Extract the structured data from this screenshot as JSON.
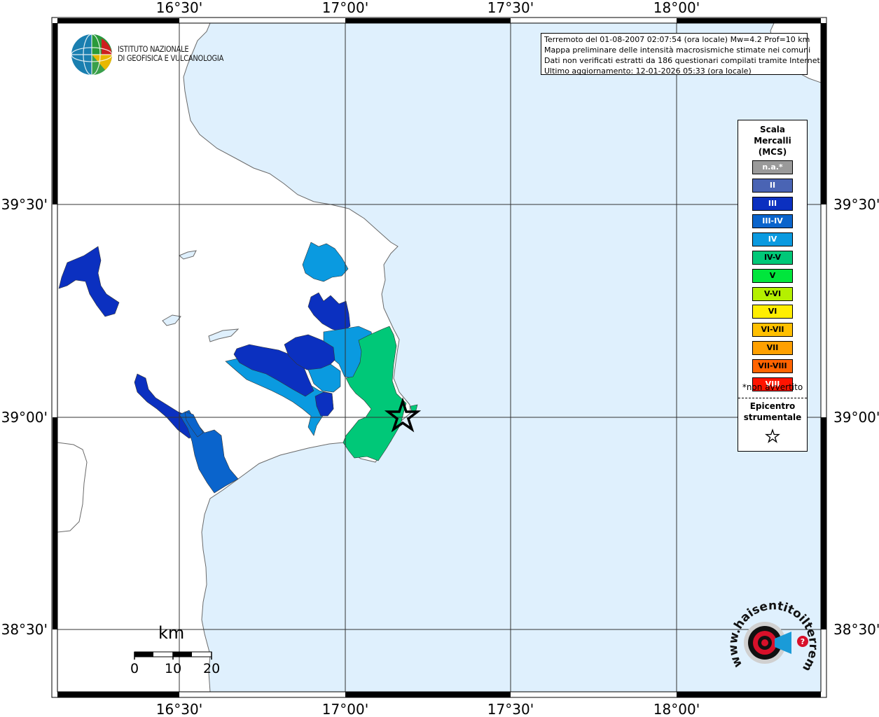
{
  "map": {
    "top_ticks": [
      "16°30'",
      "17°00'",
      "17°30'",
      "18°00'"
    ],
    "bottom_ticks": [
      "16°30'",
      "17°00'",
      "17°30'",
      "18°00'"
    ],
    "left_ticks": [
      "39°30'",
      "39°00'",
      "38°30'"
    ],
    "right_ticks": [
      "39°30'",
      "39°00'",
      "38°30'"
    ]
  },
  "logo": {
    "line1": "ISTITUTO NAZIONALE",
    "line2": "DI GEOFISICA E VULCANOLOGIA"
  },
  "info": {
    "line1": "Terremoto del 01-08-2007 02:07:54 (ora locale) Mw=4.2 Prof=10 km",
    "line2": "Mappa preliminare delle intensità macrosismiche stimate nei comuni",
    "line3": "Dati non verificati estratti da 186 questionari compilati tramite Internet.",
    "line4": "Ultimo aggiornamento: 12-01-2026 05:33 (ora locale)"
  },
  "legend": {
    "title1": "Scala",
    "title2": "Mercalli",
    "title3": "(MCS)",
    "items": [
      {
        "label": "n.a.*",
        "color": "#9a9a9a",
        "text_color": "#ffffff"
      },
      {
        "label": "II",
        "color": "#4a64b4",
        "text_color": "#ffffff"
      },
      {
        "label": "III",
        "color": "#0b30c0",
        "text_color": "#ffffff"
      },
      {
        "label": "III-IV",
        "color": "#0a64cc",
        "text_color": "#ffffff"
      },
      {
        "label": "IV",
        "color": "#0a9ae0",
        "text_color": "#ffffff"
      },
      {
        "label": "IV-V",
        "color": "#00c878",
        "text_color": "#000000"
      },
      {
        "label": "V",
        "color": "#00e63c",
        "text_color": "#000000"
      },
      {
        "label": "V-VI",
        "color": "#b4f000",
        "text_color": "#000000"
      },
      {
        "label": "VI",
        "color": "#ffee00",
        "text_color": "#000000"
      },
      {
        "label": "VI-VII",
        "color": "#ffc000",
        "text_color": "#000000"
      },
      {
        "label": "VII",
        "color": "#ffa000",
        "text_color": "#000000"
      },
      {
        "label": "VII-VIII",
        "color": "#ff6400",
        "text_color": "#000000"
      },
      {
        "label": "VIII",
        "color": "#ff1400",
        "text_color": "#ffffff"
      }
    ],
    "note": "*non avvertito",
    "epicentre1": "Epicentro",
    "epicentre2": "strumentale"
  },
  "scale_bar": {
    "unit": "km",
    "labels": [
      "0",
      "10",
      "20"
    ]
  },
  "watermark": {
    "text": "www.haisentitoilterremoto.it"
  },
  "colors": {
    "sea": "#dff0fd",
    "land": "#ffffff",
    "III": "#0b30c0",
    "III-IV": "#0a64cc",
    "IV": "#0a9ae0",
    "IV-V": "#00c878"
  }
}
